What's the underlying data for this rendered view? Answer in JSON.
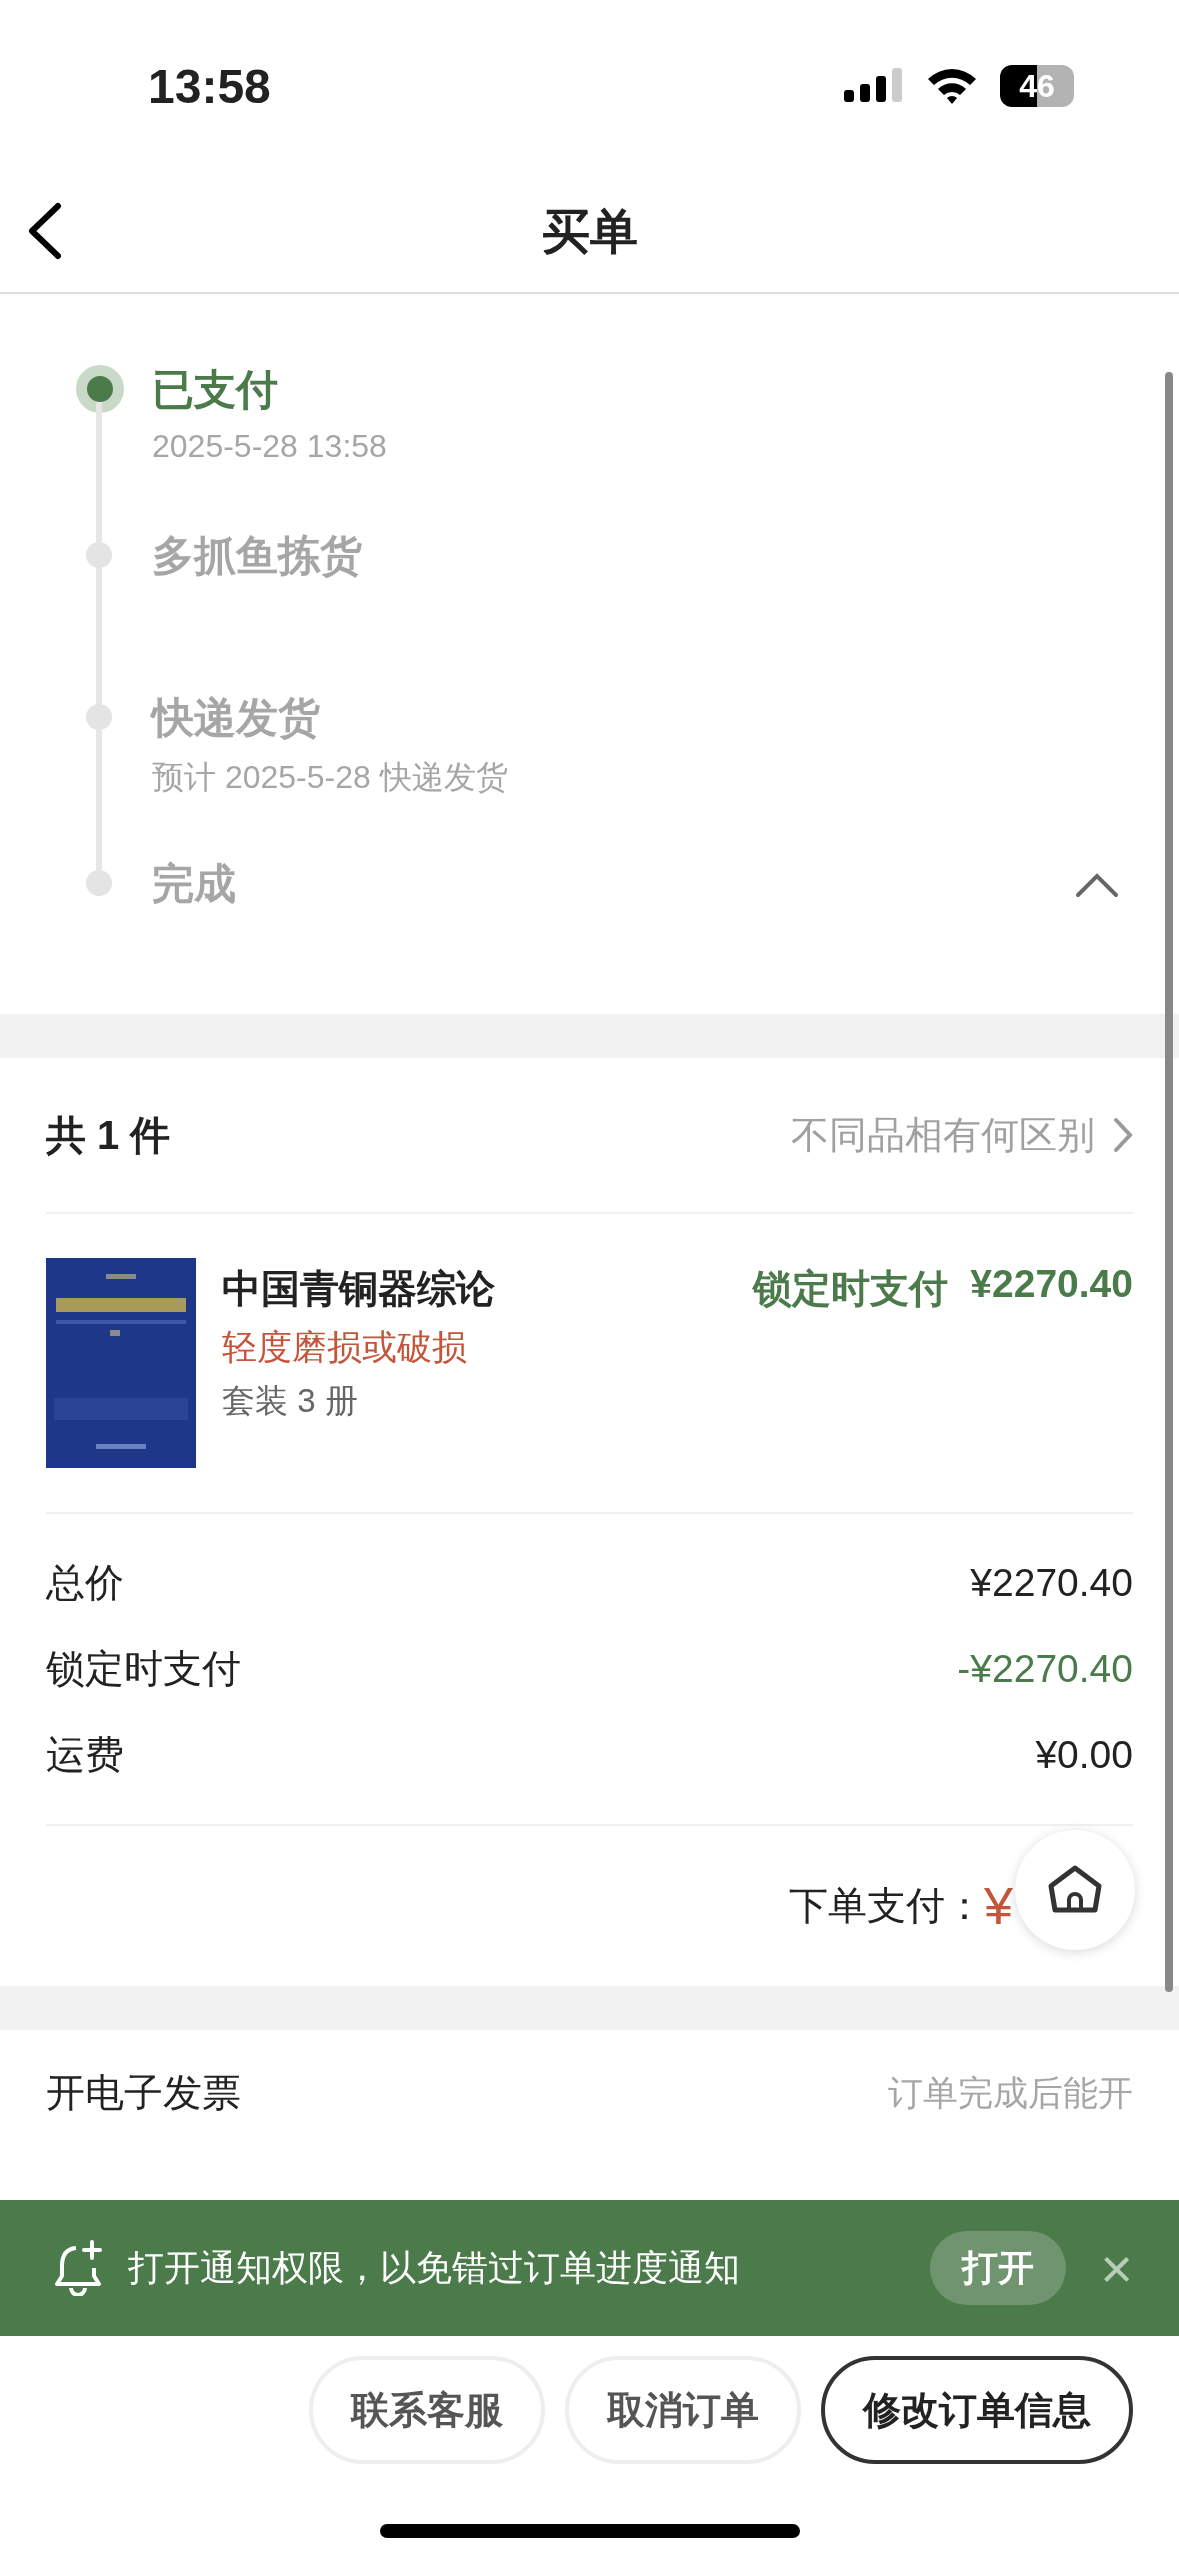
{
  "status_bar": {
    "time": "13:58",
    "battery": "46"
  },
  "header": {
    "title": "买单"
  },
  "timeline": {
    "expanded": true,
    "steps": [
      {
        "title": "已支付",
        "subtitle": "2025-5-28 13:58",
        "done": true
      },
      {
        "title": "多抓鱼拣货",
        "done": false
      },
      {
        "title": "快递发货",
        "subtitle": "预计 2025-5-28 快递发货",
        "done": false
      },
      {
        "title": "完成",
        "done": false
      }
    ]
  },
  "items": {
    "count_label": "共 1 件",
    "help_link": "不同品相有何区别",
    "products": [
      {
        "kind": "picture",
        "title": "中国青铜器综论",
        "condition": "轻度磨损或破损",
        "spec": "套装 3 册",
        "price_label": "锁定时支付",
        "price": "¥2270.40"
      }
    ]
  },
  "summary": [
    {
      "label": "总价",
      "value": "¥2270.40",
      "kind": "normal"
    },
    {
      "label": "锁定时支付",
      "value": "-¥2270.40",
      "kind": "discount"
    },
    {
      "label": "运费",
      "value": "¥0.00",
      "kind": "normal"
    }
  ],
  "payment": {
    "label": "下单支付：",
    "value": "¥"
  },
  "invoice": {
    "label": "开电子发票",
    "hint": "订单完成后能开"
  },
  "notification": {
    "text": "打开通知权限，以免错过订单进度通知",
    "action": "打开",
    "close": "×"
  },
  "actions": [
    {
      "label": "联系客服",
      "primary": false
    },
    {
      "label": "取消订单",
      "primary": false
    },
    {
      "label": "修改订单信息",
      "primary": true
    }
  ]
}
